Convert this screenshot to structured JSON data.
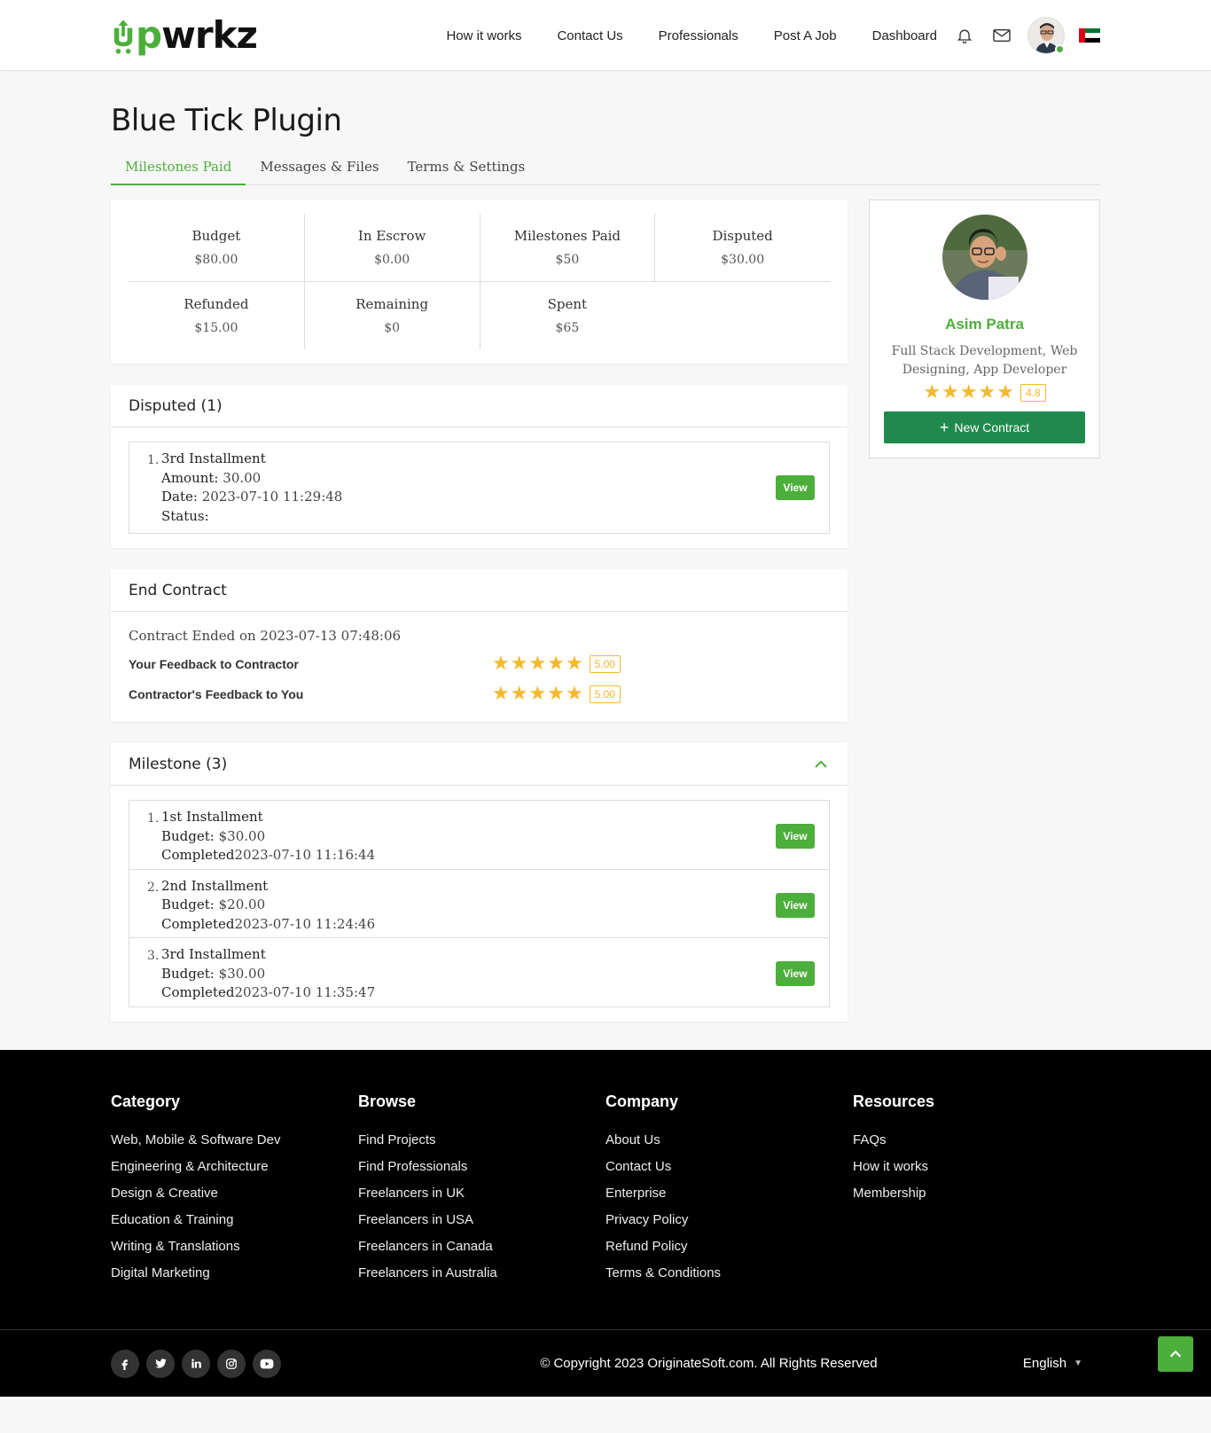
{
  "brand": {
    "logo_u": "U",
    "logo_p": "p",
    "logo_rest": "wrkz"
  },
  "nav": {
    "links": [
      "How it works",
      "Contact Us",
      "Professionals",
      "Post A Job",
      "Dashboard"
    ],
    "icons": [
      "bell-icon",
      "mail-icon"
    ]
  },
  "page": {
    "title": "Blue Tick Plugin",
    "tabs": [
      "Milestones Paid",
      "Messages & Files",
      "Terms & Settings"
    ],
    "active_tab": 0
  },
  "stats": {
    "row1": [
      {
        "label": "Budget",
        "value": "$80.00"
      },
      {
        "label": "In Escrow",
        "value": "$0.00"
      },
      {
        "label": "Milestones Paid",
        "value": "$50"
      },
      {
        "label": "Disputed",
        "value": "$30.00"
      }
    ],
    "row2": [
      {
        "label": "Refunded",
        "value": "$15.00"
      },
      {
        "label": "Remaining",
        "value": "$0"
      },
      {
        "label": "Spent",
        "value": "$65"
      }
    ]
  },
  "disputed": {
    "heading": "Disputed (1)",
    "items": [
      {
        "num": "1.",
        "title": "3rd Installment",
        "amount_label": "Amount:",
        "amount": "30.00",
        "date_label": "Date:",
        "date": "2023-07-10 11:29:48",
        "status_label": "Status:",
        "status": "",
        "button": "View"
      }
    ]
  },
  "end_contract": {
    "heading": "End Contract",
    "ended_text": "Contract Ended on 2023-07-13 07:48:06",
    "feedback": [
      {
        "label": "Your Feedback to Contractor",
        "rating": "5.00",
        "stars": 5
      },
      {
        "label": "Contractor's Feedback to You",
        "rating": "5.00",
        "stars": 5
      }
    ]
  },
  "milestones": {
    "heading": "Milestone (3)",
    "items": [
      {
        "num": "1.",
        "title": "1st Installment",
        "budget_label": "Budget:",
        "budget": "$30.00",
        "completed_label": "Completed",
        "completed": "2023-07-10 11:16:44",
        "button": "View"
      },
      {
        "num": "2.",
        "title": "2nd Installment",
        "budget_label": "Budget:",
        "budget": "$20.00",
        "completed_label": "Completed",
        "completed": "2023-07-10 11:24:46",
        "button": "View"
      },
      {
        "num": "3.",
        "title": "3rd Installment",
        "budget_label": "Budget:",
        "budget": "$30.00",
        "completed_label": "Completed",
        "completed": "2023-07-10 11:35:47",
        "button": "View"
      }
    ]
  },
  "profile": {
    "name": "Asim Patra",
    "role": "Full Stack Development, Web Designing, App Developer",
    "rating": "4.8",
    "stars": 5,
    "button": "New Contract",
    "button_icon": "+"
  },
  "footer": {
    "columns": [
      {
        "heading": "Category",
        "links": [
          "Web, Mobile & Software Dev",
          "Engineering & Architecture",
          "Design & Creative",
          "Education & Training",
          "Writing & Translations",
          "Digital Marketing"
        ]
      },
      {
        "heading": "Browse",
        "links": [
          "Find Projects",
          "Find Professionals",
          "Freelancers in UK",
          "Freelancers in USA",
          "Freelancers in Canada",
          "Freelancers in Australia"
        ]
      },
      {
        "heading": "Company",
        "links": [
          "About Us",
          "Contact Us",
          "Enterprise",
          "Privacy Policy",
          "Refund Policy",
          "Terms & Conditions"
        ]
      },
      {
        "heading": "Resources",
        "links": [
          "FAQs",
          "How it works",
          "Membership"
        ]
      }
    ],
    "socials": [
      "facebook-icon",
      "twitter-icon",
      "linkedin-icon",
      "instagram-icon",
      "youtube-icon"
    ],
    "copyright": "© Copyright 2023 OriginateSoft.com. All Rights Reserved",
    "language": "English"
  },
  "colors": {
    "accent": "#4caf3b",
    "button_dark": "#1f8a4c",
    "star": "#f5b82e",
    "footer_bg": "#000000"
  }
}
